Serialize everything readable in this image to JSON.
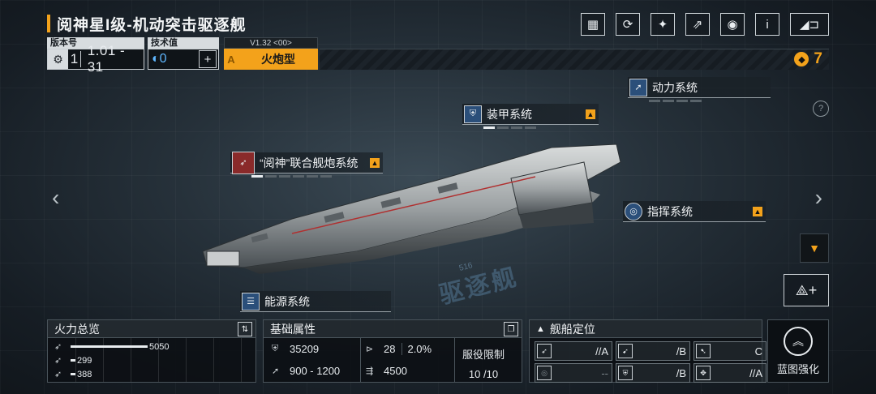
{
  "header": {
    "title": "阅神星I级-机动突击驱逐舰"
  },
  "top_icons": [
    {
      "name": "blueprint-icon",
      "glyph": "▦"
    },
    {
      "name": "refresh-icon",
      "glyph": "⟳"
    },
    {
      "name": "crew-icon",
      "glyph": "✦"
    },
    {
      "name": "share-icon",
      "glyph": "↗"
    },
    {
      "name": "view-icon",
      "glyph": "◉"
    },
    {
      "name": "info-icon",
      "glyph": "i"
    },
    {
      "name": "back-icon",
      "glyph": "◣⊐"
    }
  ],
  "info": {
    "version_label": "版本号",
    "version_major": "1",
    "version_minor": "1.01 - 31",
    "tech_label": "技术值",
    "tech_value": "0",
    "type_version": "V1.32 <00>",
    "type_grade": "A",
    "type_name": "火炮型",
    "cost": "7"
  },
  "systems": {
    "power": {
      "label": "动力系统",
      "pips": 4,
      "active": 0
    },
    "armor": {
      "label": "装甲系统",
      "pips": 4,
      "active": 1
    },
    "gun": {
      "label": "“阅神”联合舰炮系统",
      "pips": 6,
      "active": 1,
      "badge": "M"
    },
    "command": {
      "label": "指挥系统"
    },
    "energy": {
      "label": "能源系统"
    }
  },
  "watermark": {
    "text": "驱逐舰",
    "number": "516"
  },
  "firepower": {
    "title": "火力总览",
    "rows": [
      {
        "value": "5050",
        "fraction": 0.45
      },
      {
        "value": "299",
        "fraction": 0.03
      },
      {
        "value": "388",
        "fraction": 0.03
      }
    ]
  },
  "attributes": {
    "title": "基础属性",
    "hp": "35209",
    "armor": "28",
    "armor_pct": "2.0%",
    "speed": "900 - 1200",
    "warp": "4500",
    "service_label": "服役限制",
    "service_value": "10 /10"
  },
  "positioning": {
    "title": "舰船定位",
    "cells": [
      {
        "value": "//A",
        "dim": false
      },
      {
        "value": "/B",
        "dim": false
      },
      {
        "value": "C",
        "dim": false
      },
      {
        "value": "--",
        "dim": true
      },
      {
        "value": "/B",
        "dim": false
      },
      {
        "value": "//A",
        "dim": false
      }
    ]
  },
  "enhance": {
    "label": "蓝图强化"
  },
  "nav": {
    "left": "‹",
    "right": "›"
  },
  "colors": {
    "accent": "#f3a21b",
    "tech": "#5fb7ff"
  }
}
